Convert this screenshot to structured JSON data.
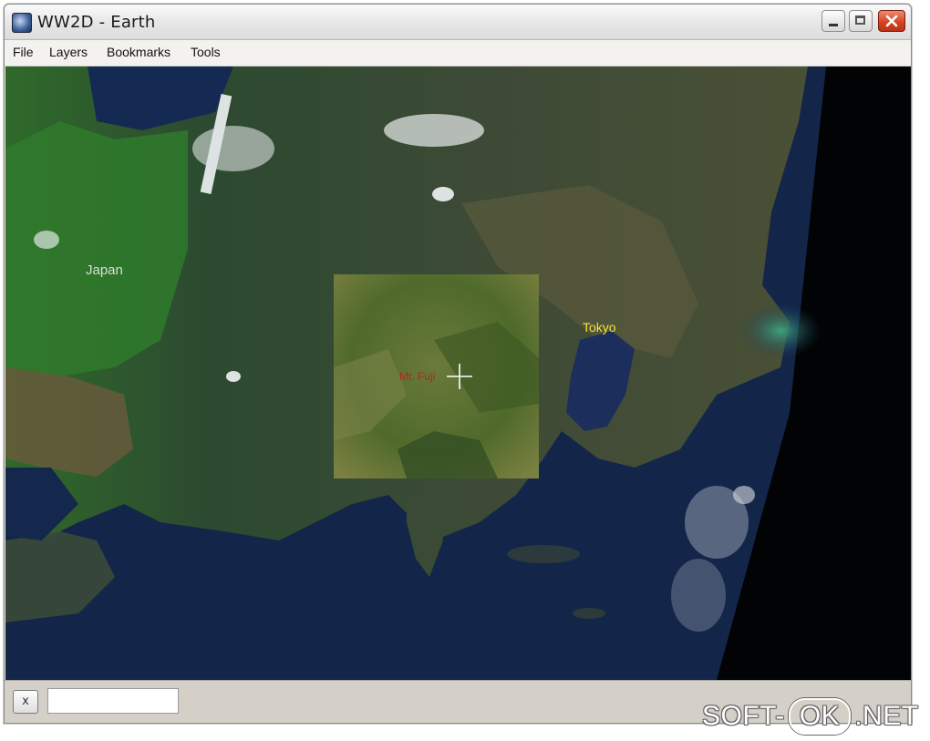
{
  "window": {
    "title": "WW2D - Earth"
  },
  "menu": {
    "items": [
      "File",
      "Layers",
      "Bookmarks",
      "Tools"
    ]
  },
  "map": {
    "labels": {
      "japan": "Japan",
      "tokyo": "Tokyo",
      "marker": "Mt. Fuji"
    },
    "colors": {
      "ocean": "#0f1d3c",
      "land": "#3a4a35",
      "tokyo_label": "#f2e23a",
      "japan_label": "#d9dfd4",
      "marker_label": "#c0221a"
    }
  },
  "status": {
    "close_label": "x",
    "input_value": "",
    "input_placeholder": ""
  },
  "watermark": {
    "left": "SOFT-",
    "pill": "OK",
    "right": ".NET"
  }
}
